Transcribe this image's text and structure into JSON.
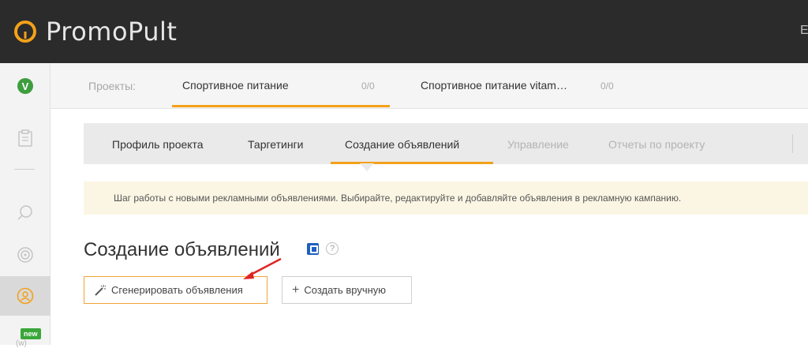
{
  "brand": {
    "name": "PromoPult",
    "accent": "#f3a11a"
  },
  "topbar": {
    "right_text": "E"
  },
  "rail": {
    "project_letter": "V",
    "new_badge": "new",
    "new_sub": "(w)"
  },
  "projects": {
    "label": "Проекты:",
    "tabs": [
      {
        "label": "Спортивное питание",
        "count": "0/0"
      },
      {
        "label": "Спортивное питание vitam…",
        "count": "0/0"
      }
    ]
  },
  "subnav": {
    "tabs": [
      {
        "label": "Профиль проекта",
        "disabled": false
      },
      {
        "label": "Таргетинги",
        "disabled": false
      },
      {
        "label": "Создание объявлений",
        "disabled": false,
        "active": true
      },
      {
        "label": "Управление",
        "disabled": true
      },
      {
        "label": "Отчеты по проекту",
        "disabled": true
      }
    ]
  },
  "info": {
    "text": "Шаг работы с новыми рекламными объявлениями. Выбирайте, редактируйте и добавляйте объявления в рекламную кампанию."
  },
  "page": {
    "title": "Создание объявлений",
    "help_symbol": "?"
  },
  "buttons": {
    "generate": "Сгенерировать объявления",
    "create_manual": "Создать вручную",
    "plus_symbol": "+"
  },
  "icons": [
    "logo-icon",
    "clipboard-icon",
    "search-icon",
    "target-icon",
    "user-icon",
    "edit-icon",
    "help-icon",
    "wand-icon",
    "arrow-annotation"
  ]
}
